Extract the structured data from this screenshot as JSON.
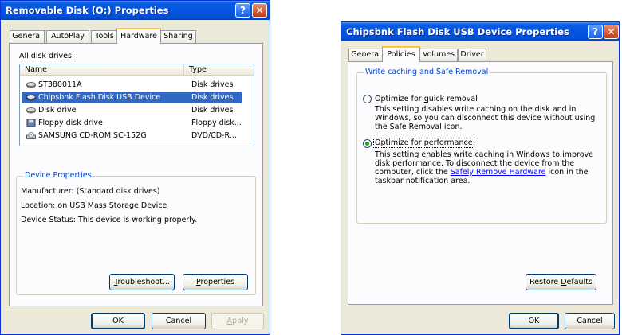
{
  "dialog1": {
    "title": "Removable Disk (O:) Properties",
    "help_label": "?",
    "close_label": "✕",
    "tabs": [
      {
        "label": "General",
        "active": false
      },
      {
        "label": "AutoPlay",
        "active": false
      },
      {
        "label": "Tools",
        "active": false
      },
      {
        "label": "Hardware",
        "active": true
      },
      {
        "label": "Sharing",
        "active": false
      }
    ],
    "all_drives_label": "All disk drives:",
    "columns": {
      "name": "Name",
      "type": "Type"
    },
    "drives": [
      {
        "name": "ST380011A",
        "type": "Disk drives",
        "icon": "hard-disk-icon",
        "selected": false
      },
      {
        "name": "Chipsbnk Flash Disk USB Device",
        "type": "Disk drives",
        "icon": "hard-disk-icon",
        "selected": true
      },
      {
        "name": "Disk drive",
        "type": "Disk drives",
        "icon": "hard-disk-icon",
        "selected": false
      },
      {
        "name": "Floppy disk drive",
        "type": "Floppy disk...",
        "icon": "floppy-drive-icon",
        "selected": false
      },
      {
        "name": "SAMSUNG CD-ROM SC-152G",
        "type": "DVD/CD-R...",
        "icon": "cd-drive-icon",
        "selected": false
      }
    ],
    "device_properties": {
      "title": "Device Properties",
      "manufacturer": "Manufacturer: (Standard disk drives)",
      "location": "Location: on USB Mass Storage Device",
      "status": "Device Status: This device is working properly."
    },
    "buttons": {
      "troubleshoot_key": "T",
      "troubleshoot_rest": "roubleshoot...",
      "properties_key": "P",
      "properties_rest": "roperties",
      "ok": "OK",
      "cancel": "Cancel",
      "apply_key": "A",
      "apply_rest": "pply"
    }
  },
  "dialog2": {
    "title": "Chipsbnk Flash Disk USB Device Properties",
    "help_label": "?",
    "close_label": "✕",
    "tabs": [
      {
        "label": "General",
        "active": false
      },
      {
        "label": "Policies",
        "active": true
      },
      {
        "label": "Volumes",
        "active": false
      },
      {
        "label": "Driver",
        "active": false
      }
    ],
    "group_title": "Write caching and Safe Removal",
    "option_quick": {
      "key": "q",
      "label_before": "Optimize for ",
      "label_after": "uick removal",
      "checked": false,
      "description": "This setting disables write caching on the disk and in Windows, so you can disconnect this device without using the Safe Removal icon."
    },
    "option_performance": {
      "key": "p",
      "label_before": "Optimize for ",
      "label_after": "erformance",
      "checked": true,
      "description_before": "This setting enables write caching in Windows to improve disk performance. To disconnect the device from the computer, click the ",
      "link": "Safely Remove Hardware",
      "description_after": " icon in the taskbar notification area."
    },
    "buttons": {
      "restore_before": "Restore ",
      "restore_key": "D",
      "restore_after": "efaults",
      "ok": "OK",
      "cancel": "Cancel"
    }
  }
}
